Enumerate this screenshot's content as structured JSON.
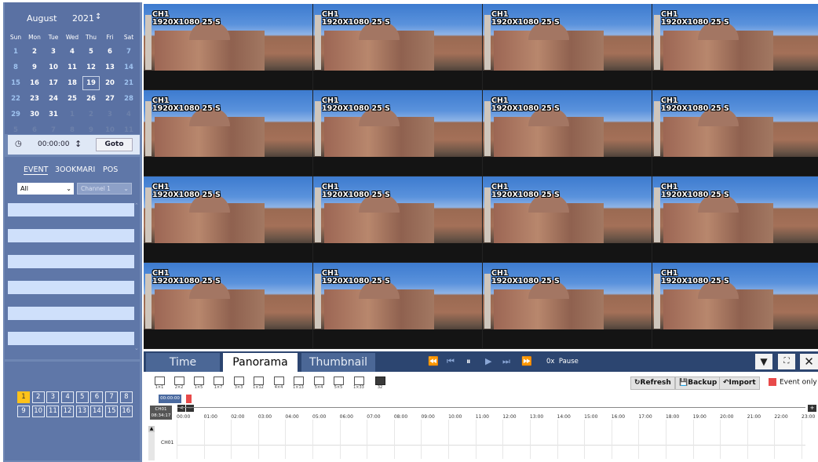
{
  "calendar": {
    "month": "August",
    "year": "2021",
    "year_spin": "↕",
    "weekdays": [
      "Sun",
      "Mon",
      "Tue",
      "Wed",
      "Thu",
      "Fri",
      "Sat"
    ],
    "days": [
      "1",
      "2",
      "3",
      "4",
      "5",
      "6",
      "7",
      "8",
      "9",
      "10",
      "11",
      "12",
      "13",
      "14",
      "15",
      "16",
      "17",
      "18",
      "19",
      "20",
      "21",
      "22",
      "23",
      "24",
      "25",
      "26",
      "27",
      "28",
      "29",
      "30",
      "31",
      "1",
      "2",
      "3",
      "4",
      "5",
      "6",
      "7",
      "8",
      "9",
      "10",
      "11"
    ],
    "selected_day": "19"
  },
  "time_jump": {
    "clock_icon": "clock-icon",
    "time": "00:00:00",
    "spin": "↕",
    "goto_label": "Goto"
  },
  "event_panel": {
    "tabs": [
      "EVENT",
      "3OOKMARI",
      "POS"
    ],
    "filter_value": "All",
    "channel_value": "Channel 1"
  },
  "channels": {
    "row1": [
      "1",
      "2",
      "3",
      "4",
      "5",
      "6",
      "7",
      "8"
    ],
    "row2": [
      "9",
      "10",
      "11",
      "12",
      "13",
      "14",
      "15",
      "16"
    ],
    "active": "1"
  },
  "video": {
    "tile_label": "CH1",
    "tile_res": "1920X1080 25 S",
    "tile_count": 16
  },
  "playback": {
    "tabs": [
      "Time",
      "Panorama",
      "Thumbnail"
    ],
    "active_tab": "Panorama",
    "controls": [
      "⏪",
      "⏮",
      "⏸",
      "▶",
      "⏭",
      "⏩"
    ],
    "speed_label": "0x",
    "state_label": "Pause"
  },
  "toolbar": {
    "layouts": [
      "1×1",
      "2×2",
      "1×5",
      "1×7",
      "3×3",
      "1×12",
      "4×4",
      "1×13",
      "5×4",
      "5×5",
      "1×33",
      "32"
    ],
    "refresh_label": "Refresh",
    "backup_label": "Backup",
    "import_label": "Import",
    "event_only_label": "Event only",
    "timestamp_small": "00:00:00",
    "channel_tag": "CH01",
    "current_time": "08:34:17",
    "row_label": "CH01"
  },
  "timeline": {
    "hours": [
      "00:00",
      "01:00",
      "02:00",
      "03:00",
      "04:00",
      "05:00",
      "06:00",
      "07:00",
      "08:00",
      "09:00",
      "10:00",
      "11:00",
      "12:00",
      "13:00",
      "14:00",
      "15:00",
      "16:00",
      "17:00",
      "18:00",
      "19:00",
      "20:00",
      "21:00",
      "22:00",
      "23:00"
    ]
  }
}
